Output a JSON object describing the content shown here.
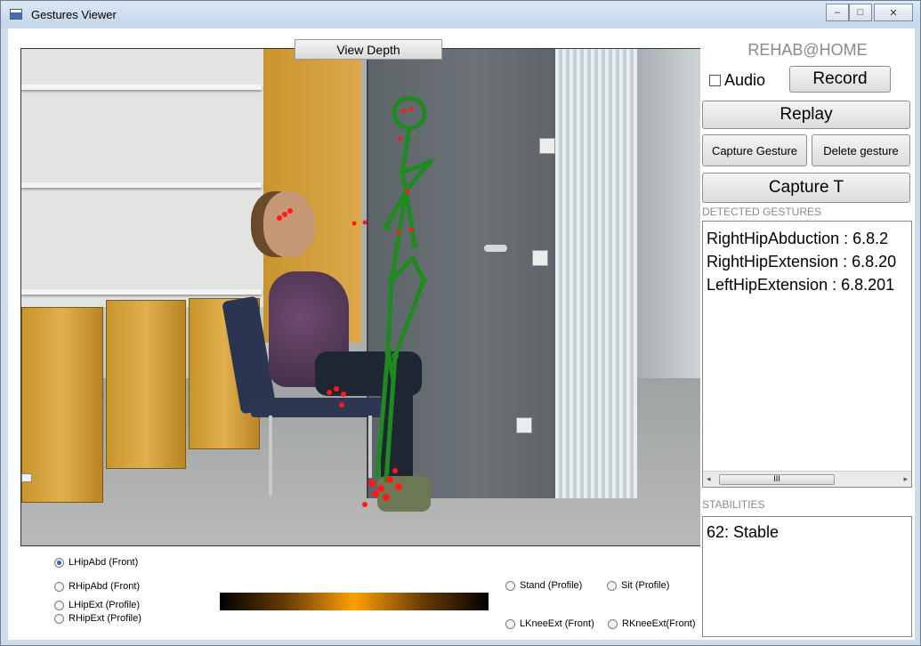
{
  "window": {
    "title": "Gestures Viewer",
    "controls": {
      "minimize": "–",
      "maximize": "□",
      "close": "✕"
    }
  },
  "video": {
    "view_depth_label": "View Depth"
  },
  "panel": {
    "brand": "REHAB@HOME",
    "audio_label": "Audio",
    "audio_checked": false,
    "record_label": "Record",
    "replay_label": "Replay",
    "capture_gesture_label": "Capture Gesture",
    "delete_gesture_label": "Delete gesture",
    "capture_t_label": "Capture T",
    "detected_header": "DETECTED GESTURES",
    "detected_gestures": [
      "RightHipAbduction : 6.8.2",
      "RightHipExtension : 6.8.20",
      "LeftHipExtension : 6.8.201"
    ],
    "stabilities_header": "STABILITIES",
    "stabilities": [
      "62: Stable"
    ],
    "scroll_thumb": "III",
    "scroll_left": "◂",
    "scroll_right": "▸"
  },
  "gestures": {
    "left_column": [
      {
        "label": "LHipAbd (Front)",
        "checked": true
      },
      {
        "label": "RHipAbd (Front)",
        "checked": false
      },
      {
        "label": "LHipExt (Profile)",
        "checked": false
      },
      {
        "label": "RHipExt (Profile)",
        "checked": false
      }
    ],
    "stand": "Stand (Profile)",
    "sit": "Sit (Profile)",
    "lknee": "LKneeExt (Front)",
    "rknee": "RKneeExt(Front)"
  },
  "colors": {
    "skeleton": "#1f8a1f",
    "points": "#ff1a1a"
  }
}
